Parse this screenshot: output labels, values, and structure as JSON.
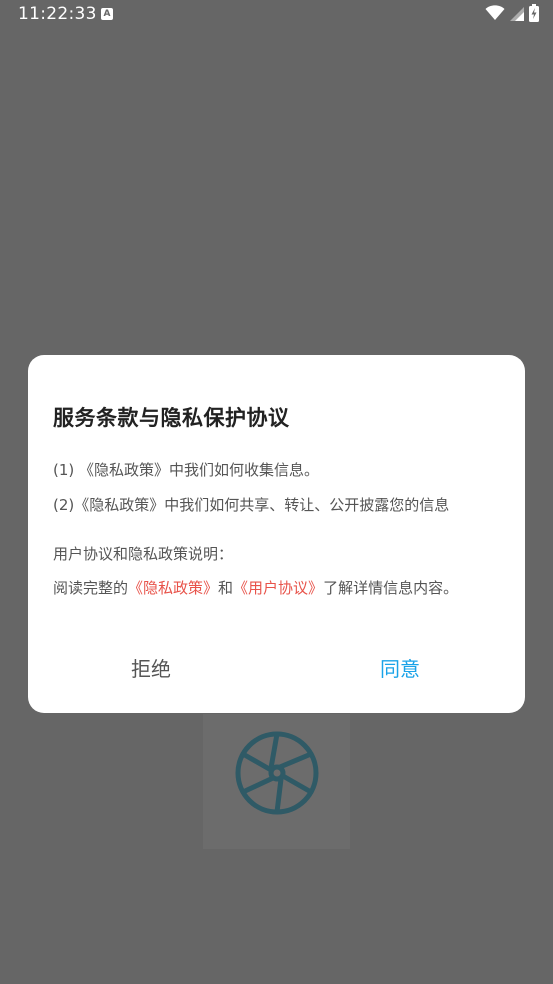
{
  "status_bar": {
    "time": "11:22:33",
    "notification_icon_letter": "A"
  },
  "dialog": {
    "title": "服务条款与隐私保护协议",
    "item1": "(1) 《隐私政策》中我们如何收集信息。",
    "item2": "(2)《隐私政策》中我们如何共享、转让、公开披露您的信息",
    "subtitle": "用户协议和隐私政策说明：",
    "read_prefix": "阅读完整的",
    "privacy_link": "《隐私政策》",
    "and_text": "和",
    "user_agreement_link": "《用户协议》",
    "read_suffix": "了解详情信息内容。",
    "reject_label": "拒绝",
    "agree_label": "同意"
  },
  "colors": {
    "overlay": "#666666",
    "link": "#e8534a",
    "agree": "#1aa3e8",
    "logo": "#2f5a66"
  },
  "icons": {
    "background_logo": "aperture-icon",
    "wifi": "wifi-icon",
    "signal": "cell-signal-icon",
    "battery": "battery-charging-icon"
  }
}
